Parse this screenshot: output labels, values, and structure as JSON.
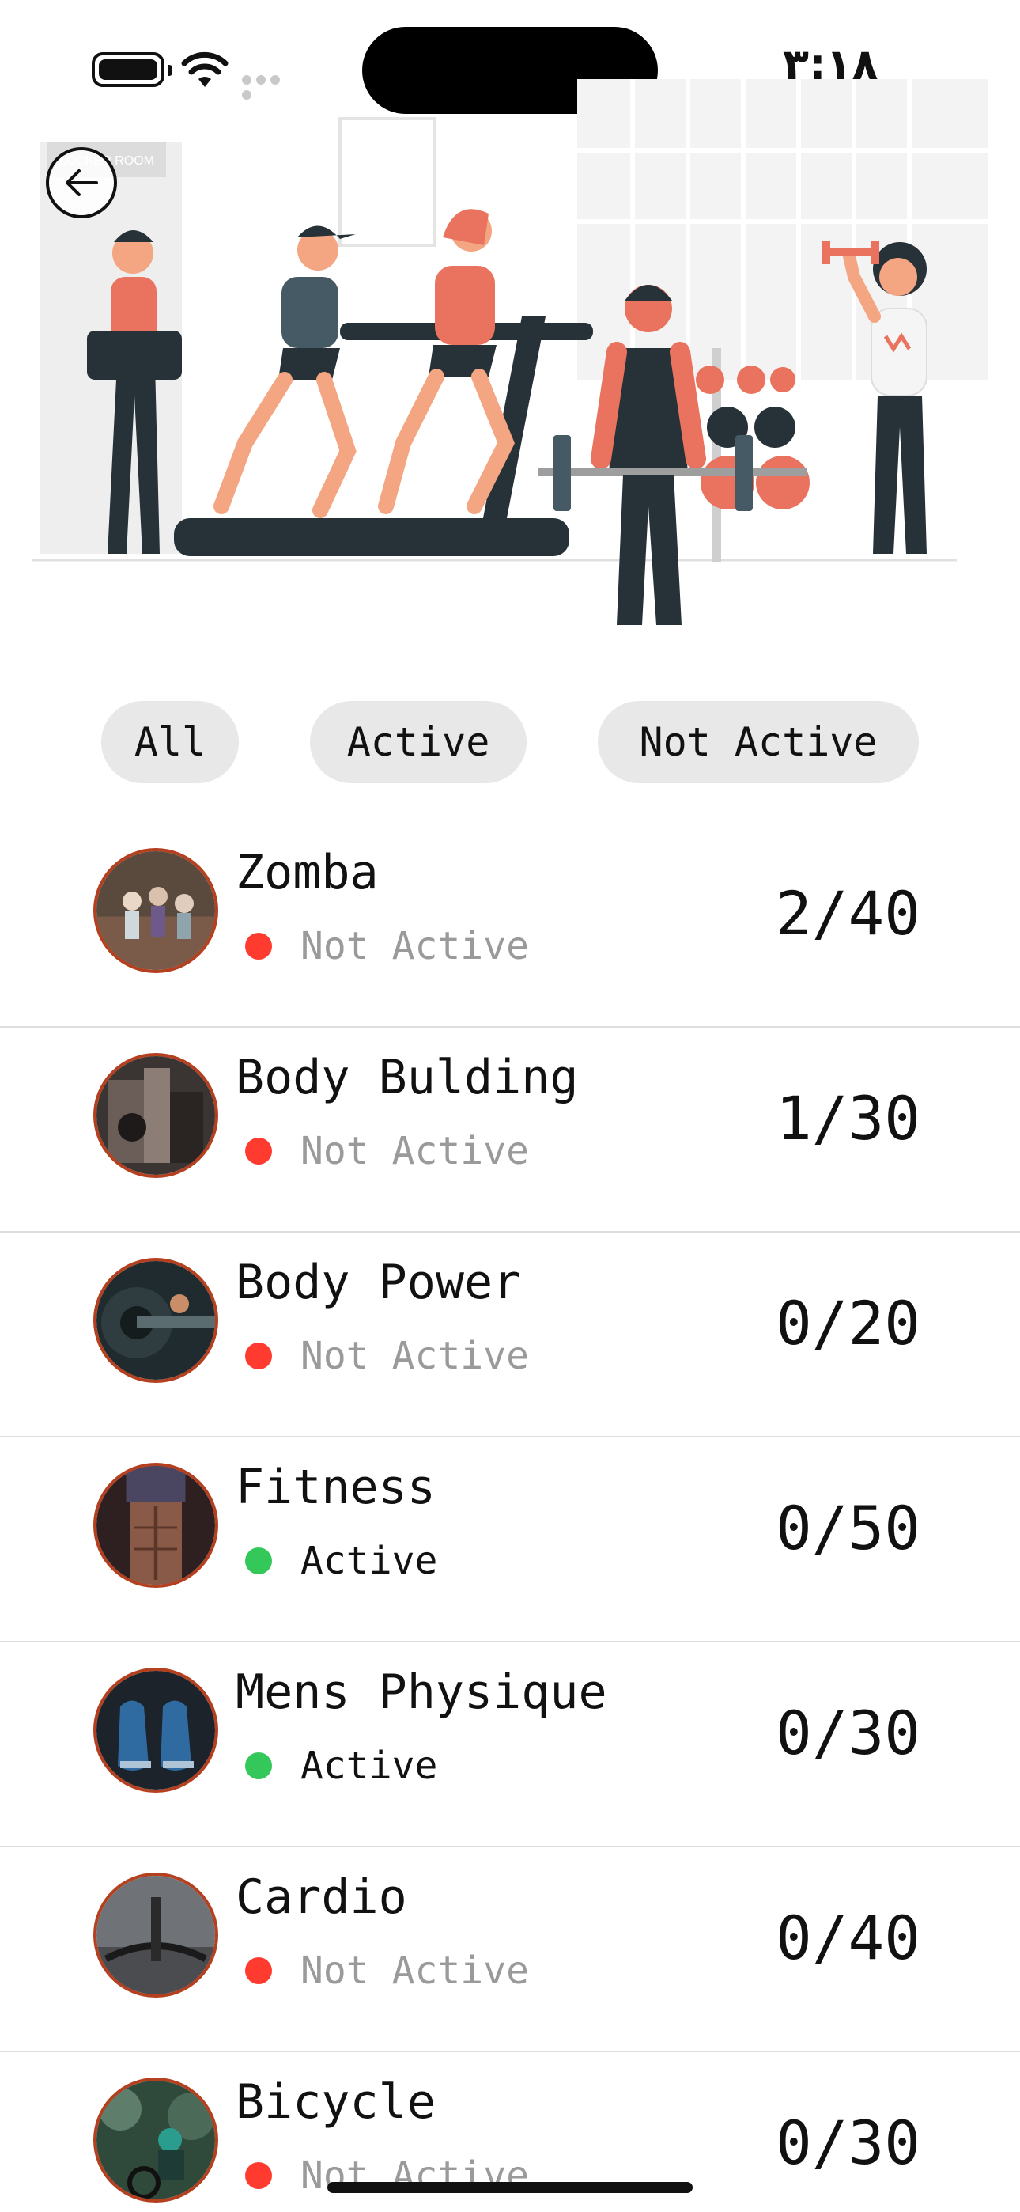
{
  "status_bar": {
    "time": "٣:١٨"
  },
  "filters": [
    {
      "label": "All"
    },
    {
      "label": "Active"
    },
    {
      "label": "Not Active"
    }
  ],
  "colors": {
    "active": "#34c759",
    "not_active": "#ff3b30",
    "accent": "#e9735e",
    "dark": "#263238"
  },
  "classes": [
    {
      "name": "Zomba",
      "status": "Not Active",
      "active": false,
      "count": "2/40",
      "thumb": "group-class-photo"
    },
    {
      "name": "Body Bulding",
      "status": "Not Active",
      "active": false,
      "count": "1/30",
      "thumb": "barbell-gym-photo"
    },
    {
      "name": "Body Power",
      "status": "Not Active",
      "active": false,
      "count": "0/20",
      "thumb": "weight-plate-photo"
    },
    {
      "name": "Fitness",
      "status": "Active",
      "active": true,
      "count": "0/50",
      "thumb": "abs-photo"
    },
    {
      "name": "Mens Physique",
      "status": "Active",
      "active": true,
      "count": "0/30",
      "thumb": "sneakers-photo"
    },
    {
      "name": "Cardio",
      "status": "Not Active",
      "active": false,
      "count": "0/40",
      "thumb": "bike-handlebar-photo"
    },
    {
      "name": "Bicycle",
      "status": "Not Active",
      "active": false,
      "count": "0/30",
      "thumb": "cyclist-photo"
    }
  ]
}
